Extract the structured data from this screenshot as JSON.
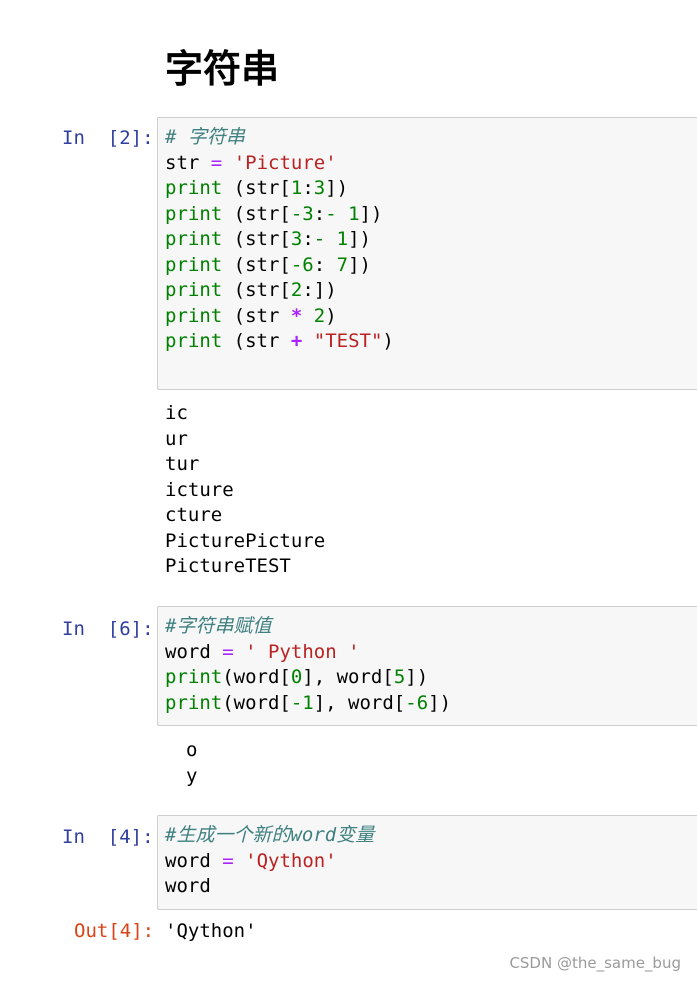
{
  "title": "字符串",
  "cells": [
    {
      "prompt": "In  [2]:",
      "code": {
        "l1": "# 字符串",
        "l2": {
          "a": "str",
          "op": "=",
          "s": "'Picture'"
        },
        "l3": {
          "kw": "print",
          "a": "(str[",
          "n1": "1",
          "sep": ":",
          "n2": "3",
          "b": "])"
        },
        "l4": {
          "kw": "print",
          "a": "(str[",
          "n1": "-3",
          "sep": ":",
          "n2": "- 1",
          "b": "])"
        },
        "l5": {
          "kw": "print",
          "a": "(str[",
          "n1": "3",
          "sep": ":",
          "n2": "- 1",
          "b": "])"
        },
        "l6": {
          "kw": "print",
          "a": "(str[",
          "n1": "-6",
          "sep": ": ",
          "n2": "7",
          "b": "])"
        },
        "l7": {
          "kw": "print",
          "a": "(str[",
          "n1": "2",
          "sep": ":",
          "b": "])"
        },
        "l8": {
          "kw": "print",
          "a": "(str ",
          "op": "*",
          "n": "2",
          "b": ")"
        },
        "l9": {
          "kw": "print",
          "a": "(str ",
          "op": "+",
          "s": "\"TEST\"",
          "b": ")"
        }
      },
      "output": [
        "ic",
        "ur",
        "tur",
        "icture",
        "cture",
        "PicturePicture",
        "PictureTEST"
      ]
    },
    {
      "prompt": "In  [6]:",
      "code": {
        "l1": "#字符串赋值",
        "l2": {
          "a": "word",
          "op": "=",
          "s": "' Python '"
        },
        "l3": {
          "kw": "print",
          "a": "(word[",
          "n1": "0",
          "b": "], word[",
          "n2": "5",
          "c": "])"
        },
        "l4": {
          "kw": "print",
          "a": "(word[",
          "n1": "-1",
          "b": "], word[",
          "n2": "-6",
          "c": "])"
        }
      },
      "output": [
        "o",
        "y"
      ]
    },
    {
      "prompt": "In  [4]:",
      "code": {
        "l1": "#生成一个新的word变量",
        "l2": {
          "a": "word",
          "op": "=",
          "s": "'Qython'"
        },
        "l3": "word"
      },
      "out_prompt": "Out[4]:",
      "out_value": "'Qython'"
    }
  ],
  "watermark": "CSDN @the_same_bug",
  "colors": {
    "in_prompt": "#303f9f",
    "out_prompt": "#d84315",
    "comment": "#408080",
    "keyword": "#008000",
    "operator": "#aa22ff",
    "string": "#ba2121",
    "cell_bg": "#f7f7f7"
  }
}
